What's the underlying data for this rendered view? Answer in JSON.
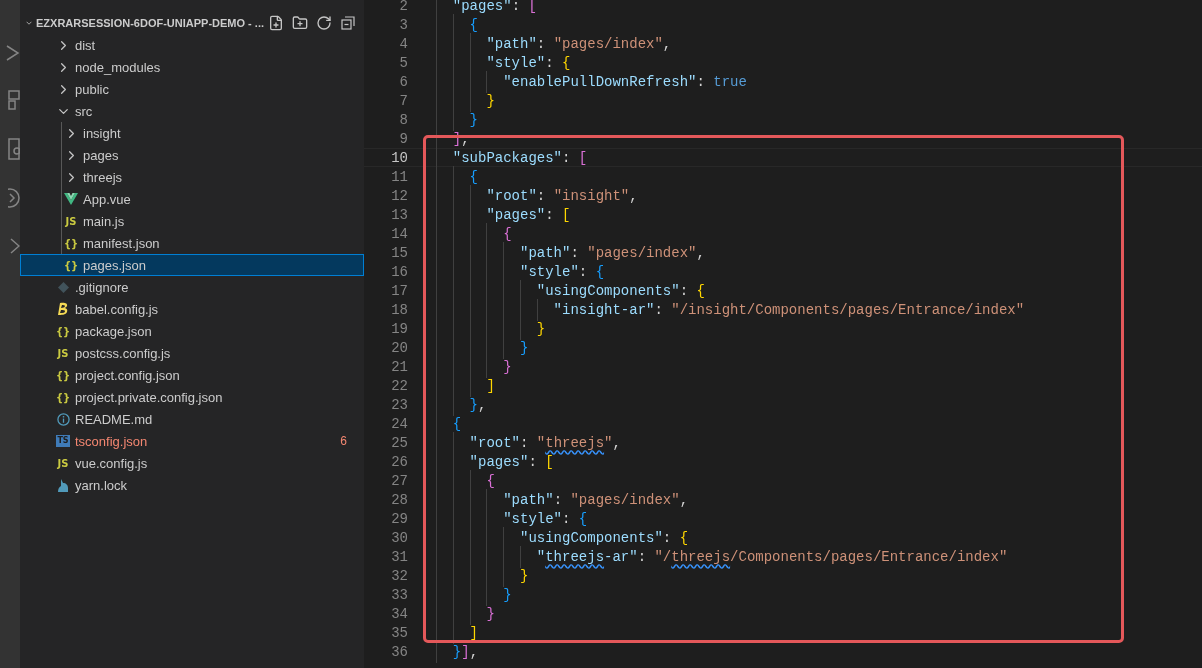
{
  "explorer": {
    "title": "EZXRARSESSION-6DOF-UNIAPP-DEMO - ...",
    "tree": [
      {
        "label": "dist",
        "kind": "folder",
        "expanded": false,
        "selected": false
      },
      {
        "label": "node_modules",
        "kind": "folder",
        "expanded": false,
        "selected": false
      },
      {
        "label": "public",
        "kind": "folder",
        "expanded": false,
        "selected": false
      },
      {
        "label": "src",
        "kind": "folder",
        "expanded": true,
        "selected": false,
        "children": [
          {
            "label": "insight",
            "kind": "folder",
            "expanded": false,
            "selected": false
          },
          {
            "label": "pages",
            "kind": "folder",
            "expanded": false,
            "selected": false
          },
          {
            "label": "threejs",
            "kind": "folder",
            "expanded": false,
            "selected": false
          },
          {
            "label": "App.vue",
            "kind": "vue",
            "selected": false
          },
          {
            "label": "main.js",
            "kind": "js",
            "glyph": "JS",
            "selected": false
          },
          {
            "label": "manifest.json",
            "kind": "json",
            "glyph": "{}",
            "selected": false
          },
          {
            "label": "pages.json",
            "kind": "json",
            "glyph": "{}",
            "selected": true
          }
        ]
      },
      {
        "label": ".gitignore",
        "kind": "git",
        "selected": false
      },
      {
        "label": "babel.config.js",
        "kind": "babel",
        "selected": false
      },
      {
        "label": "package.json",
        "kind": "json",
        "glyph": "{}",
        "selected": false
      },
      {
        "label": "postcss.config.js",
        "kind": "js",
        "glyph": "JS",
        "selected": false
      },
      {
        "label": "project.config.json",
        "kind": "json",
        "glyph": "{}",
        "selected": false
      },
      {
        "label": "project.private.config.json",
        "kind": "json",
        "glyph": "{}",
        "selected": false
      },
      {
        "label": "README.md",
        "kind": "info",
        "selected": false
      },
      {
        "label": "tsconfig.json",
        "kind": "ts",
        "glyph": "TS",
        "selected": false,
        "error": true,
        "problems": "6"
      },
      {
        "label": "vue.config.js",
        "kind": "js",
        "glyph": "JS",
        "selected": false
      },
      {
        "label": "yarn.lock",
        "kind": "yarn",
        "selected": false
      }
    ]
  },
  "editor": {
    "highlight_frame": true,
    "lines": [
      {
        "number": "2",
        "current": false,
        "tokens": [
          {
            "kind": "key",
            "text": "  \"pages\""
          },
          {
            "kind": "punct",
            "text": ": "
          },
          {
            "kind": "pink",
            "text": "["
          }
        ]
      },
      {
        "number": "3",
        "current": false,
        "tokens": [
          {
            "kind": "blue",
            "text": "    {"
          }
        ]
      },
      {
        "number": "4",
        "current": false,
        "tokens": [
          {
            "kind": "key",
            "text": "      \"path\""
          },
          {
            "kind": "punct",
            "text": ": "
          },
          {
            "kind": "string",
            "text": "\"pages/index\""
          },
          {
            "kind": "punct",
            "text": ","
          }
        ]
      },
      {
        "number": "5",
        "current": false,
        "tokens": [
          {
            "kind": "key",
            "text": "      \"style\""
          },
          {
            "kind": "punct",
            "text": ": "
          },
          {
            "kind": "gold",
            "text": "{"
          }
        ]
      },
      {
        "number": "6",
        "current": false,
        "tokens": [
          {
            "kind": "key",
            "text": "        \"enablePullDownRefresh\""
          },
          {
            "kind": "punct",
            "text": ": "
          },
          {
            "kind": "boolean",
            "text": "true"
          }
        ]
      },
      {
        "number": "7",
        "current": false,
        "tokens": [
          {
            "kind": "gold",
            "text": "      }"
          }
        ]
      },
      {
        "number": "8",
        "current": false,
        "tokens": [
          {
            "kind": "blue",
            "text": "    }"
          }
        ]
      },
      {
        "number": "9",
        "current": false,
        "tokens": [
          {
            "kind": "pink",
            "text": "  ]"
          },
          {
            "kind": "punct",
            "text": ","
          }
        ]
      },
      {
        "number": "10",
        "current": true,
        "tokens": [
          {
            "kind": "key",
            "text": "  \"subPackages\""
          },
          {
            "kind": "punct",
            "text": ": "
          },
          {
            "kind": "pink",
            "text": "["
          }
        ]
      },
      {
        "number": "11",
        "current": false,
        "tokens": [
          {
            "kind": "blue",
            "text": "    {"
          }
        ]
      },
      {
        "number": "12",
        "current": false,
        "tokens": [
          {
            "kind": "key",
            "text": "      \"root\""
          },
          {
            "kind": "punct",
            "text": ": "
          },
          {
            "kind": "string",
            "text": "\"insight\""
          },
          {
            "kind": "punct",
            "text": ","
          }
        ]
      },
      {
        "number": "13",
        "current": false,
        "tokens": [
          {
            "kind": "key",
            "text": "      \"pages\""
          },
          {
            "kind": "punct",
            "text": ": "
          },
          {
            "kind": "gold",
            "text": "["
          }
        ]
      },
      {
        "number": "14",
        "current": false,
        "tokens": [
          {
            "kind": "pink",
            "text": "        {"
          }
        ]
      },
      {
        "number": "15",
        "current": false,
        "tokens": [
          {
            "kind": "key",
            "text": "          \"path\""
          },
          {
            "kind": "punct",
            "text": ": "
          },
          {
            "kind": "string",
            "text": "\"pages/index\""
          },
          {
            "kind": "punct",
            "text": ","
          }
        ]
      },
      {
        "number": "16",
        "current": false,
        "tokens": [
          {
            "kind": "key",
            "text": "          \"style\""
          },
          {
            "kind": "punct",
            "text": ": "
          },
          {
            "kind": "blue",
            "text": "{"
          }
        ]
      },
      {
        "number": "17",
        "current": false,
        "tokens": [
          {
            "kind": "key",
            "text": "            \"usingComponents\""
          },
          {
            "kind": "punct",
            "text": ": "
          },
          {
            "kind": "gold",
            "text": "{"
          }
        ]
      },
      {
        "number": "18",
        "current": false,
        "tokens": [
          {
            "kind": "key",
            "text": "              \"insight-ar\""
          },
          {
            "kind": "punct",
            "text": ": "
          },
          {
            "kind": "string",
            "text": "\"/insight/Components/pages/Entrance/index\""
          }
        ]
      },
      {
        "number": "19",
        "current": false,
        "tokens": [
          {
            "kind": "gold",
            "text": "            }"
          }
        ]
      },
      {
        "number": "20",
        "current": false,
        "tokens": [
          {
            "kind": "blue",
            "text": "          }"
          }
        ]
      },
      {
        "number": "21",
        "current": false,
        "tokens": [
          {
            "kind": "pink",
            "text": "        }"
          }
        ]
      },
      {
        "number": "22",
        "current": false,
        "tokens": [
          {
            "kind": "gold",
            "text": "      ]"
          }
        ]
      },
      {
        "number": "23",
        "current": false,
        "tokens": [
          {
            "kind": "blue",
            "text": "    }"
          },
          {
            "kind": "punct",
            "text": ","
          }
        ]
      },
      {
        "number": "24",
        "current": false,
        "tokens": [
          {
            "kind": "blue",
            "text": "  {"
          }
        ]
      },
      {
        "number": "25",
        "current": false,
        "tokens": [
          {
            "kind": "key",
            "text": "    \"root\""
          },
          {
            "kind": "punct",
            "text": ": "
          },
          {
            "kind": "string",
            "text": "\""
          },
          {
            "kind": "string",
            "text": "threejs",
            "flagged": true
          },
          {
            "kind": "string",
            "text": "\""
          },
          {
            "kind": "punct",
            "text": ","
          }
        ]
      },
      {
        "number": "26",
        "current": false,
        "tokens": [
          {
            "kind": "key",
            "text": "    \"pages\""
          },
          {
            "kind": "punct",
            "text": ": "
          },
          {
            "kind": "gold",
            "text": "["
          }
        ]
      },
      {
        "number": "27",
        "current": false,
        "tokens": [
          {
            "kind": "pink",
            "text": "      {"
          }
        ]
      },
      {
        "number": "28",
        "current": false,
        "tokens": [
          {
            "kind": "key",
            "text": "        \"path\""
          },
          {
            "kind": "punct",
            "text": ": "
          },
          {
            "kind": "string",
            "text": "\"pages/index\""
          },
          {
            "kind": "punct",
            "text": ","
          }
        ]
      },
      {
        "number": "29",
        "current": false,
        "tokens": [
          {
            "kind": "key",
            "text": "        \"style\""
          },
          {
            "kind": "punct",
            "text": ": "
          },
          {
            "kind": "blue",
            "text": "{"
          }
        ]
      },
      {
        "number": "30",
        "current": false,
        "tokens": [
          {
            "kind": "key",
            "text": "          \"usingComponents\""
          },
          {
            "kind": "punct",
            "text": ": "
          },
          {
            "kind": "gold",
            "text": "{"
          }
        ]
      },
      {
        "number": "31",
        "current": false,
        "tokens": [
          {
            "kind": "key",
            "text": "            \""
          },
          {
            "kind": "key",
            "text": "threejs",
            "flagged": true
          },
          {
            "kind": "key",
            "text": "-ar\""
          },
          {
            "kind": "punct",
            "text": ": "
          },
          {
            "kind": "string",
            "text": "\"/"
          },
          {
            "kind": "string",
            "text": "threejs",
            "flagged": true
          },
          {
            "kind": "string",
            "text": "/Components/pages/Entrance/index\""
          }
        ]
      },
      {
        "number": "32",
        "current": false,
        "tokens": [
          {
            "kind": "gold",
            "text": "          }"
          }
        ]
      },
      {
        "number": "33",
        "current": false,
        "tokens": [
          {
            "kind": "blue",
            "text": "        }"
          }
        ]
      },
      {
        "number": "34",
        "current": false,
        "tokens": [
          {
            "kind": "pink",
            "text": "      }"
          }
        ]
      },
      {
        "number": "35",
        "current": false,
        "tokens": [
          {
            "kind": "gold",
            "text": "    ]"
          }
        ]
      },
      {
        "number": "36",
        "current": false,
        "tokens": [
          {
            "kind": "blue",
            "text": "  }"
          },
          {
            "kind": "pink",
            "text": "]"
          },
          {
            "kind": "punct",
            "text": ","
          }
        ]
      }
    ]
  }
}
